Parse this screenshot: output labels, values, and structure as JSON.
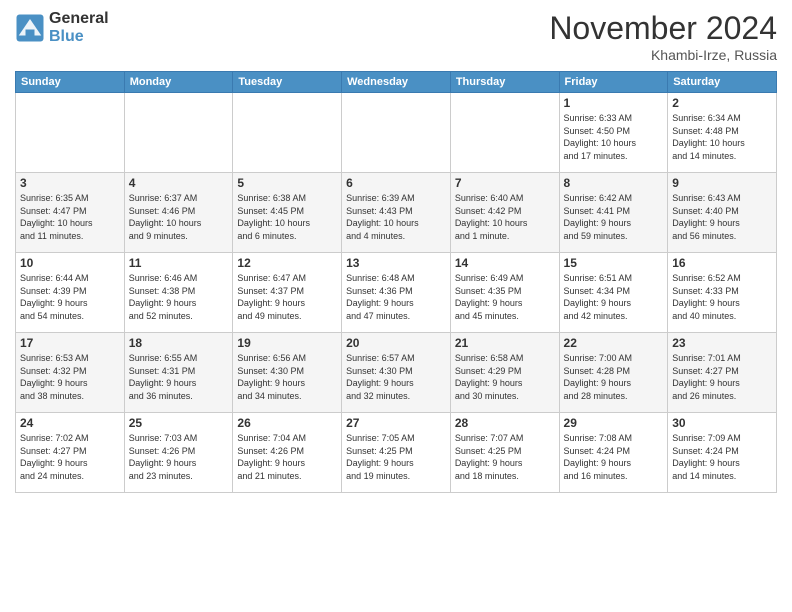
{
  "header": {
    "logo_general": "General",
    "logo_blue": "Blue",
    "title": "November 2024",
    "location": "Khambi-Irze, Russia"
  },
  "days_of_week": [
    "Sunday",
    "Monday",
    "Tuesday",
    "Wednesday",
    "Thursday",
    "Friday",
    "Saturday"
  ],
  "weeks": [
    {
      "days": [
        {
          "num": "",
          "info": ""
        },
        {
          "num": "",
          "info": ""
        },
        {
          "num": "",
          "info": ""
        },
        {
          "num": "",
          "info": ""
        },
        {
          "num": "",
          "info": ""
        },
        {
          "num": "1",
          "info": "Sunrise: 6:33 AM\nSunset: 4:50 PM\nDaylight: 10 hours\nand 17 minutes."
        },
        {
          "num": "2",
          "info": "Sunrise: 6:34 AM\nSunset: 4:48 PM\nDaylight: 10 hours\nand 14 minutes."
        }
      ]
    },
    {
      "days": [
        {
          "num": "3",
          "info": "Sunrise: 6:35 AM\nSunset: 4:47 PM\nDaylight: 10 hours\nand 11 minutes."
        },
        {
          "num": "4",
          "info": "Sunrise: 6:37 AM\nSunset: 4:46 PM\nDaylight: 10 hours\nand 9 minutes."
        },
        {
          "num": "5",
          "info": "Sunrise: 6:38 AM\nSunset: 4:45 PM\nDaylight: 10 hours\nand 6 minutes."
        },
        {
          "num": "6",
          "info": "Sunrise: 6:39 AM\nSunset: 4:43 PM\nDaylight: 10 hours\nand 4 minutes."
        },
        {
          "num": "7",
          "info": "Sunrise: 6:40 AM\nSunset: 4:42 PM\nDaylight: 10 hours\nand 1 minute."
        },
        {
          "num": "8",
          "info": "Sunrise: 6:42 AM\nSunset: 4:41 PM\nDaylight: 9 hours\nand 59 minutes."
        },
        {
          "num": "9",
          "info": "Sunrise: 6:43 AM\nSunset: 4:40 PM\nDaylight: 9 hours\nand 56 minutes."
        }
      ]
    },
    {
      "days": [
        {
          "num": "10",
          "info": "Sunrise: 6:44 AM\nSunset: 4:39 PM\nDaylight: 9 hours\nand 54 minutes."
        },
        {
          "num": "11",
          "info": "Sunrise: 6:46 AM\nSunset: 4:38 PM\nDaylight: 9 hours\nand 52 minutes."
        },
        {
          "num": "12",
          "info": "Sunrise: 6:47 AM\nSunset: 4:37 PM\nDaylight: 9 hours\nand 49 minutes."
        },
        {
          "num": "13",
          "info": "Sunrise: 6:48 AM\nSunset: 4:36 PM\nDaylight: 9 hours\nand 47 minutes."
        },
        {
          "num": "14",
          "info": "Sunrise: 6:49 AM\nSunset: 4:35 PM\nDaylight: 9 hours\nand 45 minutes."
        },
        {
          "num": "15",
          "info": "Sunrise: 6:51 AM\nSunset: 4:34 PM\nDaylight: 9 hours\nand 42 minutes."
        },
        {
          "num": "16",
          "info": "Sunrise: 6:52 AM\nSunset: 4:33 PM\nDaylight: 9 hours\nand 40 minutes."
        }
      ]
    },
    {
      "days": [
        {
          "num": "17",
          "info": "Sunrise: 6:53 AM\nSunset: 4:32 PM\nDaylight: 9 hours\nand 38 minutes."
        },
        {
          "num": "18",
          "info": "Sunrise: 6:55 AM\nSunset: 4:31 PM\nDaylight: 9 hours\nand 36 minutes."
        },
        {
          "num": "19",
          "info": "Sunrise: 6:56 AM\nSunset: 4:30 PM\nDaylight: 9 hours\nand 34 minutes."
        },
        {
          "num": "20",
          "info": "Sunrise: 6:57 AM\nSunset: 4:30 PM\nDaylight: 9 hours\nand 32 minutes."
        },
        {
          "num": "21",
          "info": "Sunrise: 6:58 AM\nSunset: 4:29 PM\nDaylight: 9 hours\nand 30 minutes."
        },
        {
          "num": "22",
          "info": "Sunrise: 7:00 AM\nSunset: 4:28 PM\nDaylight: 9 hours\nand 28 minutes."
        },
        {
          "num": "23",
          "info": "Sunrise: 7:01 AM\nSunset: 4:27 PM\nDaylight: 9 hours\nand 26 minutes."
        }
      ]
    },
    {
      "days": [
        {
          "num": "24",
          "info": "Sunrise: 7:02 AM\nSunset: 4:27 PM\nDaylight: 9 hours\nand 24 minutes."
        },
        {
          "num": "25",
          "info": "Sunrise: 7:03 AM\nSunset: 4:26 PM\nDaylight: 9 hours\nand 23 minutes."
        },
        {
          "num": "26",
          "info": "Sunrise: 7:04 AM\nSunset: 4:26 PM\nDaylight: 9 hours\nand 21 minutes."
        },
        {
          "num": "27",
          "info": "Sunrise: 7:05 AM\nSunset: 4:25 PM\nDaylight: 9 hours\nand 19 minutes."
        },
        {
          "num": "28",
          "info": "Sunrise: 7:07 AM\nSunset: 4:25 PM\nDaylight: 9 hours\nand 18 minutes."
        },
        {
          "num": "29",
          "info": "Sunrise: 7:08 AM\nSunset: 4:24 PM\nDaylight: 9 hours\nand 16 minutes."
        },
        {
          "num": "30",
          "info": "Sunrise: 7:09 AM\nSunset: 4:24 PM\nDaylight: 9 hours\nand 14 minutes."
        }
      ]
    }
  ]
}
